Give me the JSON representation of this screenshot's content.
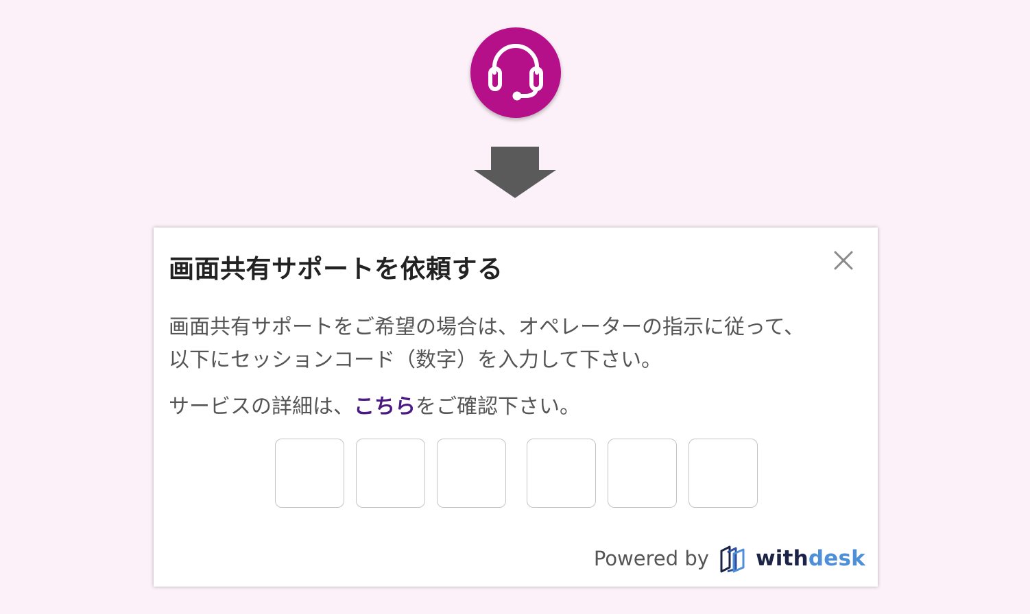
{
  "support_button": {
    "icon": "headset-icon",
    "color": "#b5108a"
  },
  "arrow": {
    "icon": "arrow-down-icon",
    "color": "#5a5a5a"
  },
  "dialog": {
    "title": "画面共有サポートを依頼する",
    "close_icon": "close-icon",
    "instruction_line1": "画面共有サポートをご希望の場合は、オペレーターの指示に従って、",
    "instruction_line2": "以下にセッションコード（数字）を入力して下さい。",
    "details_prefix": "サービスの詳細は、",
    "details_link": "こちら",
    "details_suffix": "をご確認下さい。",
    "link_color": "#4a1a82",
    "code_inputs": [
      "",
      "",
      "",
      "",
      "",
      ""
    ],
    "footer": {
      "powered_by": "Powered by",
      "logo_icon": "withdesk-logo-icon",
      "brand_part1": "with",
      "brand_part2": "desk",
      "brand_color1": "#1b2346",
      "brand_color2": "#4f8fd8"
    }
  }
}
